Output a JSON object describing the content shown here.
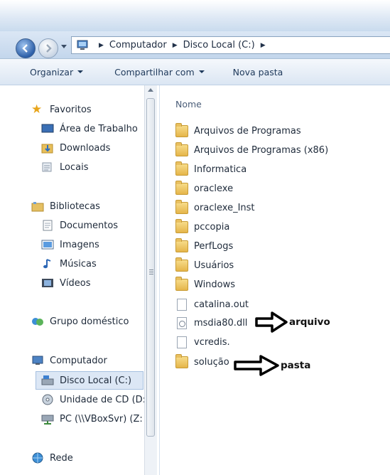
{
  "address": {
    "crumbs": [
      "Computador",
      "Disco Local (C:)"
    ]
  },
  "toolbar": {
    "organize": "Organizar",
    "share": "Compartilhar com",
    "new_folder": "Nova pasta"
  },
  "nav": {
    "favorites": {
      "label": "Favoritos",
      "items": [
        "Área de Trabalho",
        "Downloads",
        "Locais"
      ]
    },
    "libraries": {
      "label": "Bibliotecas",
      "items": [
        "Documentos",
        "Imagens",
        "Músicas",
        "Vídeos"
      ]
    },
    "homegroup": "Grupo doméstico",
    "computer": {
      "label": "Computador",
      "items": [
        "Disco Local (C:)",
        "Unidade de CD (D:",
        "PC (\\\\VBoxSvr) (Z:"
      ]
    },
    "network": "Rede"
  },
  "files": {
    "column_name": "Nome",
    "folders": [
      "Arquivos de Programas",
      "Arquivos de Programas (x86)",
      "Informatica",
      "oraclexe",
      "oraclexe_Inst",
      "pccopia",
      "PerfLogs",
      "Usuários",
      "Windows"
    ],
    "documents": [
      "catalina.out",
      "msdia80.dll",
      "vcredis."
    ],
    "last_folder": "solução"
  },
  "annotations": {
    "arquivo": "arquivo",
    "pasta": "pasta"
  }
}
